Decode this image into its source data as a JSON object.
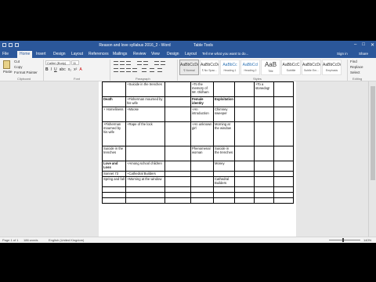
{
  "title_bar": {
    "title": "Reason and love syllabus 2016_2 - Word",
    "context": "Table Tools",
    "controls": [
      "–",
      "□",
      "✕"
    ]
  },
  "tabs": [
    "File",
    "Home",
    "Insert",
    "Design",
    "Layout",
    "References",
    "Mailings",
    "Review",
    "View",
    "Design",
    "Layout"
  ],
  "tell_me": "Tell me what you want to do...",
  "sign_in": "Sign in",
  "share": "Share",
  "ribbon": {
    "clipboard": {
      "paste": "Paste",
      "cut": "Cut",
      "copy": "Copy",
      "format_painter": "Format Painter",
      "label": "Clipboard"
    },
    "font": {
      "name": "Calibri (Body)",
      "size": "11",
      "label": "Font"
    },
    "paragraph": {
      "label": "Paragraph"
    },
    "styles": {
      "items": [
        {
          "sample": "AaBbCcDc",
          "name": "¶ Normal"
        },
        {
          "sample": "AaBbCcDc",
          "name": "¶ No Spac..."
        },
        {
          "sample": "AaBbCc",
          "name": "Heading 1"
        },
        {
          "sample": "AaBbCcI",
          "name": "Heading 2"
        },
        {
          "sample": "AaB",
          "name": "Title"
        },
        {
          "sample": "AaBbCcC",
          "name": "Subtitle"
        },
        {
          "sample": "AaBbCcDc",
          "name": "Subtle Em..."
        },
        {
          "sample": "AaBbCcDc",
          "name": "Emphasis"
        }
      ],
      "label": "Styles"
    },
    "editing": {
      "find": "Find",
      "replace": "Replace",
      "select": "Select",
      "label": "Editing"
    }
  },
  "table": {
    "rows": [
      [
        "",
        "+Suicide in the trenches",
        "",
        "+To the memory of Mr. Oldham",
        "",
        "",
        "+To a stonedog!",
        ""
      ],
      [
        "Death",
        "+Fisherman mourned by his wife",
        "",
        "Female identity",
        "Exploitation",
        "",
        "",
        ""
      ],
      [
        "+ Homeliness",
        "+Moose",
        "",
        "+An introduction",
        "Chimney sweeper",
        "",
        "",
        ""
      ],
      [
        "+Fisherman mourned by his wife",
        "+Rape of the lock",
        "",
        "+An unknown girl",
        "Morning at the window",
        "",
        "",
        ""
      ],
      [
        "Suicide in the trenches",
        "",
        "",
        "Phenomenal woman",
        "Suicide in the trenches",
        "",
        "",
        ""
      ],
      [
        "Love and Loss",
        "+Among school children",
        "",
        "",
        "Money",
        "",
        "",
        ""
      ],
      [
        "Sonnet 73",
        "+Cathedral Builders",
        "",
        "",
        "",
        "",
        "",
        ""
      ],
      [
        "Spring and fall",
        "+Morning at the window",
        "",
        "",
        "Cathedral Builders",
        "",
        "",
        ""
      ],
      [
        "",
        "",
        "",
        "",
        "",
        "",
        "",
        ""
      ],
      [
        "",
        "",
        "",
        "",
        "",
        "",
        "",
        ""
      ],
      [
        "",
        "",
        "",
        "",
        "",
        "",
        "",
        ""
      ]
    ],
    "bold_cells": [
      [
        1,
        0
      ],
      [
        1,
        3
      ],
      [
        1,
        4
      ],
      [
        5,
        0
      ]
    ]
  },
  "status": {
    "page": "Page 1 of 1",
    "words": "186 words",
    "language": "English (United Kingdom)",
    "zoom": "140%"
  }
}
